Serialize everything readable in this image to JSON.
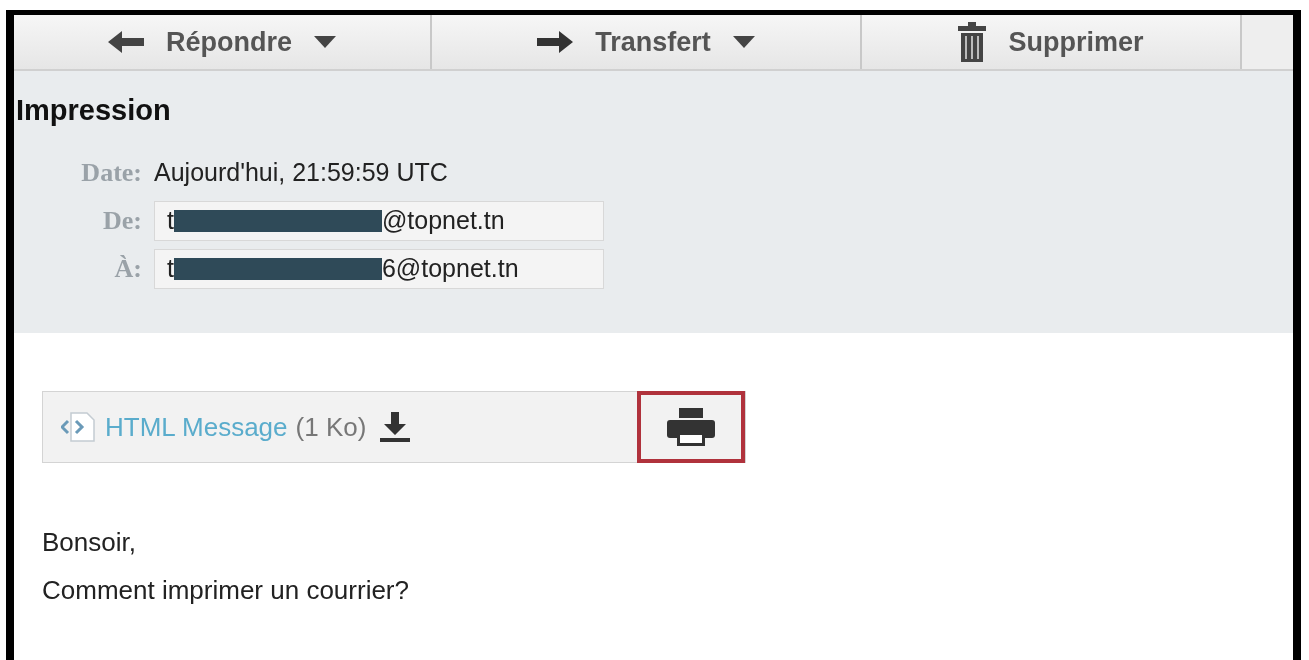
{
  "toolbar": [
    {
      "label": "Répondre",
      "dropdown": true
    },
    {
      "label": "Transfert",
      "dropdown": true
    },
    {
      "label": "Supprimer",
      "dropdown": false
    }
  ],
  "message": {
    "subject": "Impression",
    "date": {
      "label": "Date:",
      "value": "Aujourd'hui, 21:59:59 UTC"
    },
    "from": {
      "label": "De:",
      "prefix": "t",
      "suffix": "@topnet.tn"
    },
    "to": {
      "label": "À:",
      "prefix": "t",
      "suffix": "6@topnet.tn"
    }
  },
  "attachment": {
    "name": "HTML Message",
    "size": "(1 Ko)",
    "print_highlighted": true
  },
  "body": [
    "Bonsoir,",
    "Comment imprimer un courrier?"
  ]
}
